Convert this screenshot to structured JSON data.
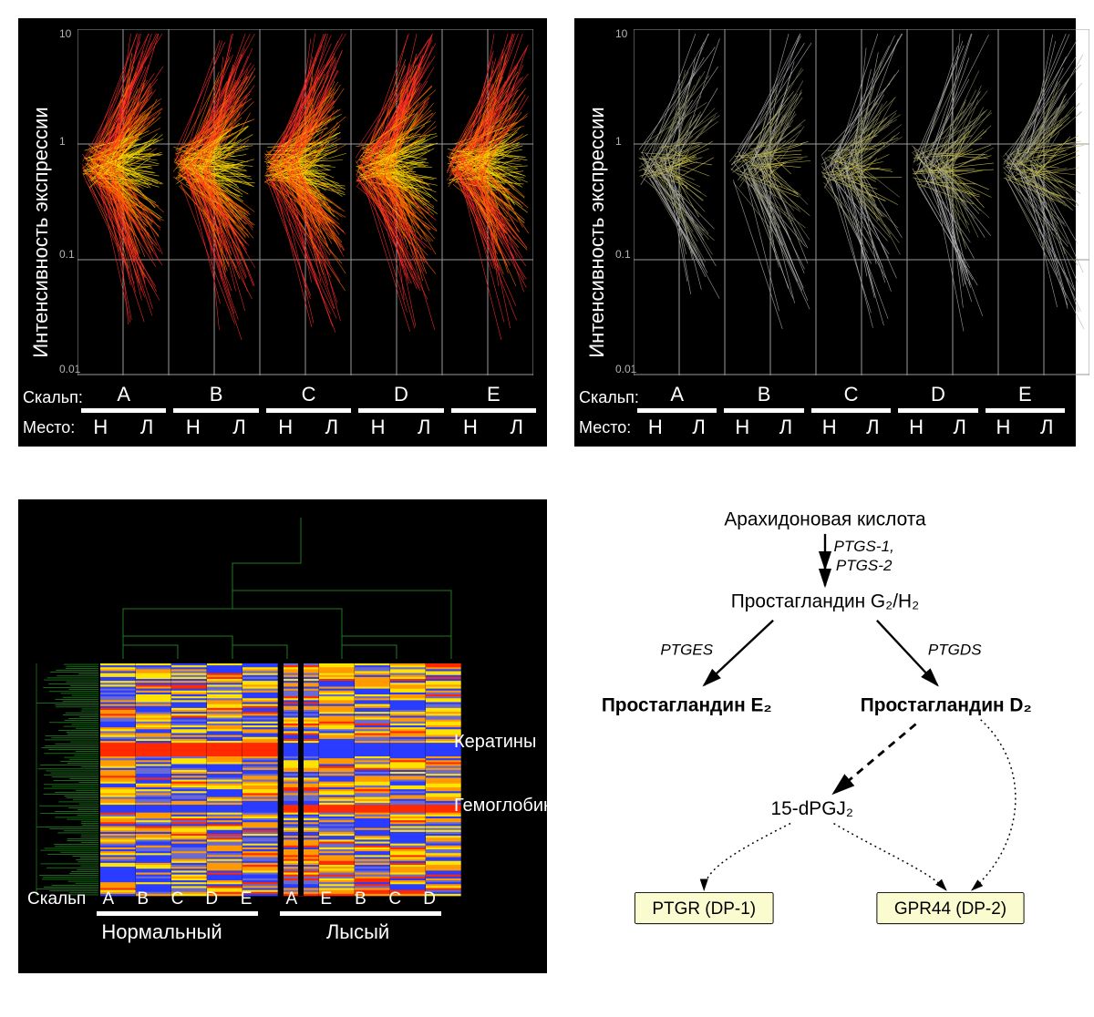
{
  "chart_data": [
    {
      "type": "line",
      "id": "panel_top_left",
      "title": "",
      "ylabel": "Интенсивность экспрессии",
      "xlabel_rows": {
        "scalp": "Скальп:",
        "site": "Место:"
      },
      "y_scale": "log",
      "ylim": [
        0.01,
        10
      ],
      "yticks": [
        0.01,
        0.1,
        1,
        10
      ],
      "ytick_labels": [
        "0.01",
        "0.1",
        "1",
        "10"
      ],
      "scalp_groups": [
        "A",
        "B",
        "C",
        "D",
        "E"
      ],
      "site_labels": [
        "Н",
        "Л"
      ],
      "description": "Parallel-coordinate normalized expression profiles for ~250 genes across 5 scalps (A–E), haired (Н) vs bald (Л). Lines are colored by expression centroid: yellow ≈ 1 (unchanged), orange–red = strongly differential; most lines converge near 1 with a fan of orange/red lines diverging toward 0.05–0.1 and toward 5–10 in each pair.",
      "approx_line_count": 250,
      "color_map": {
        "low_change": "#f5d400",
        "high_change": "#ff6a00",
        "extreme": "#ff2a2a"
      }
    },
    {
      "type": "line",
      "id": "panel_top_right",
      "title": "",
      "ylabel": "Интенсивность экспрессии",
      "xlabel_rows": {
        "scalp": "Скальп:",
        "site": "Место:"
      },
      "y_scale": "log",
      "ylim": [
        0.01,
        10
      ],
      "yticks": [
        0.01,
        0.1,
        1,
        10
      ],
      "ytick_labels": [
        "0.01",
        "0.1",
        "1",
        "10"
      ],
      "scalp_groups": [
        "A",
        "B",
        "C",
        "D",
        "E"
      ],
      "site_labels": [
        "Н",
        "Л"
      ],
      "description": "Same layout as left panel but for a smaller/filtered gene set (~100 lines); colors are desaturated yellow/olive/grey, fewer strong outliers.",
      "approx_line_count": 100,
      "color_map": {
        "low_change": "#c9bf4e",
        "high_change": "#8a8a60",
        "extreme": "#b0b0b0"
      }
    },
    {
      "type": "heatmap",
      "id": "panel_bottom_left",
      "row_label": "Скальп",
      "columns_normal": [
        "A",
        "B",
        "C",
        "D",
        "E"
      ],
      "columns_bald": [
        "A",
        "E",
        "B",
        "C",
        "D"
      ],
      "group_labels": {
        "normal": "Нормальный",
        "bald": "Лысый"
      },
      "annotations": [
        {
          "label": "Кератины",
          "approx_row_fraction": 0.38
        },
        {
          "label": "Гемоглобины",
          "approx_row_fraction": 0.62
        }
      ],
      "color_scale": {
        "low": "#2040ff",
        "mid": "#ffe400",
        "high": "#ff2200"
      },
      "clustering": "hierarchical on both axes; column dendrogram splits Normal (A–E) vs Bald (A,E,B,C,D)",
      "approx_row_count": 300
    },
    {
      "type": "pathway-diagram",
      "id": "panel_bottom_right",
      "nodes": {
        "arachidonic": "Арахидоновая кислота",
        "pg_g2h2": "Простагландин G₂/H₂",
        "pg_e2": "Простагландин E₂",
        "pg_d2": "Простагландин D₂",
        "dpgj2": "15-dPGJ₂",
        "ptgr": "PTGR (DP-1)",
        "gpr44": "GPR44 (DP-2)"
      },
      "edge_enzymes": {
        "arachidonic_to_g2h2": [
          "PTGS-1,",
          "PTGS-2"
        ],
        "g2h2_to_e2": "PTGES",
        "g2h2_to_d2": "PTGDS"
      },
      "edges": [
        {
          "from": "arachidonic",
          "to": "pg_g2h2",
          "style": "solid"
        },
        {
          "from": "pg_g2h2",
          "to": "pg_e2",
          "style": "solid"
        },
        {
          "from": "pg_g2h2",
          "to": "pg_d2",
          "style": "solid"
        },
        {
          "from": "pg_d2",
          "to": "dpgj2",
          "style": "dashed-thick"
        },
        {
          "from": "dpgj2",
          "to": "ptgr",
          "style": "dotted"
        },
        {
          "from": "dpgj2",
          "to": "gpr44",
          "style": "dotted"
        },
        {
          "from": "pg_d2",
          "to": "gpr44",
          "style": "dotted"
        }
      ]
    }
  ]
}
